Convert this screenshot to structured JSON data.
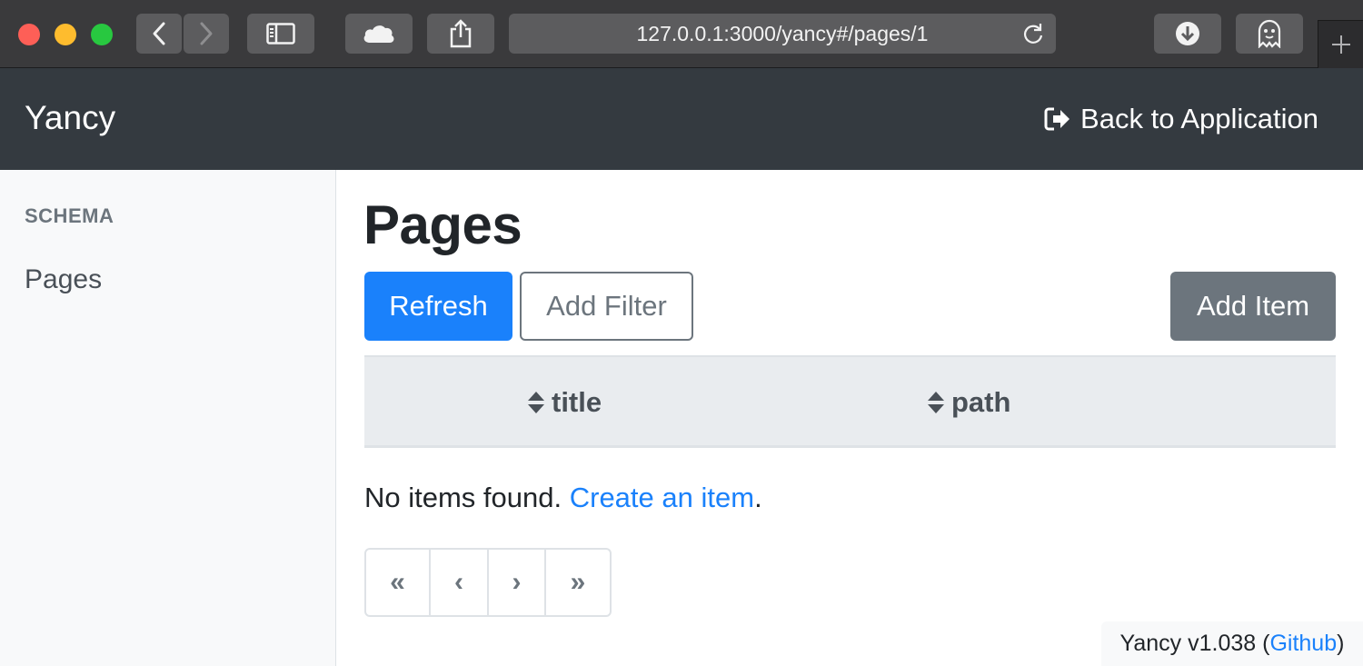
{
  "browser": {
    "url": "127.0.0.1:3000/yancy#/pages/1"
  },
  "navbar": {
    "brand": "Yancy",
    "back_label": "Back to Application"
  },
  "sidebar": {
    "heading": "SCHEMA",
    "items": [
      {
        "label": "Pages"
      }
    ]
  },
  "main": {
    "title": "Pages",
    "refresh_label": "Refresh",
    "add_filter_label": "Add Filter",
    "add_item_label": "Add Item",
    "columns": [
      {
        "label": "title"
      },
      {
        "label": "path"
      }
    ],
    "empty_text": "No items found.",
    "create_link": "Create an item",
    "empty_period": ".",
    "pager": [
      "«",
      "‹",
      "›",
      "»"
    ]
  },
  "footer": {
    "version": "Yancy v1.038 (",
    "github": "Github",
    "close_paren": ")"
  },
  "colors": {
    "primary": "#1a81fb",
    "secondary": "#6c757d",
    "navbar": "#343a40"
  }
}
